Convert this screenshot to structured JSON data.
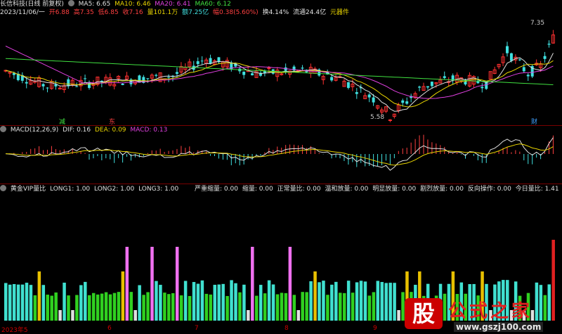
{
  "header": {
    "title": "长信科技(日线 前复权)",
    "ma": [
      {
        "label": "MA5: 6.65",
        "color": "#e0e0e0"
      },
      {
        "label": "MA10: 6.46",
        "color": "#e8d400"
      },
      {
        "label": "MA20: 6.41",
        "color": "#e040e0"
      },
      {
        "label": "MA60: 6.12",
        "color": "#40e040"
      }
    ],
    "quote": {
      "date": "2023/11/06/一",
      "open": "开6.88",
      "high": "高7.35",
      "low": "低6.85",
      "close": "收7.16",
      "volume": "量101.1万",
      "amount": "额7.25亿",
      "change": "幅0.38(5.60%)",
      "turnover": "换4.14%",
      "float": "流通24.4亿",
      "sector": "元器件"
    }
  },
  "price_chart": {
    "high_label": "7.35",
    "low_label": "5.58",
    "markers": [
      {
        "label": "减",
        "color": "#40e040"
      },
      {
        "label": "东",
        "color": "#ff4040"
      },
      {
        "label": "财",
        "color": "#40a0ff"
      }
    ],
    "up_color": "#ff3030",
    "down_color": "#40e0e0"
  },
  "macd": {
    "label": "MACD(12,26,9)",
    "dif": "DIF: 0.16",
    "dea": "DEA: 0.09",
    "macd": "MACD: 0.13"
  },
  "vol": {
    "label": "黄金VIP量比",
    "long1": "LONG1: 1.00",
    "long2": "LONG2: 1.00",
    "long3": "LONG3: 1.00",
    "stats": [
      {
        "label": "严重缩量: 0.00"
      },
      {
        "label": "缩量: 0.00"
      },
      {
        "label": "正常量比: 0.00"
      },
      {
        "label": "温和放量: 0.00"
      },
      {
        "label": "明显放量: 0.00"
      },
      {
        "label": "剧烈放量: 0.00"
      },
      {
        "label": "反向操作: 0.00"
      },
      {
        "label": "今日量比: 1.41"
      }
    ]
  },
  "x_axis": [
    "2023年5",
    "6",
    "7",
    "8",
    "9"
  ],
  "watermark": {
    "logo": "股",
    "name": "公式之家",
    "url": "www.gszj100.com"
  }
}
